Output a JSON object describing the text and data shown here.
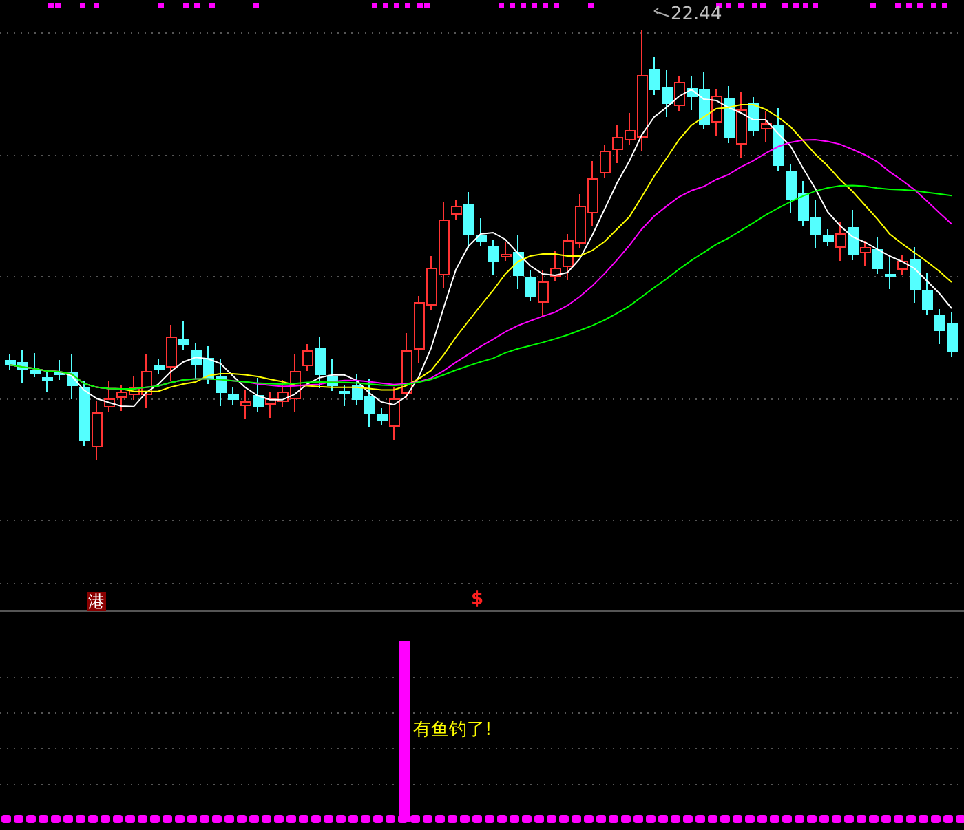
{
  "price_chart": {
    "high_label": "22.44",
    "markers": [
      {
        "kind": "badge",
        "text": "港"
      },
      {
        "kind": "dollar",
        "text": "$"
      }
    ]
  },
  "signal_panel": {
    "signal_text": "有鱼钓了!"
  }
}
